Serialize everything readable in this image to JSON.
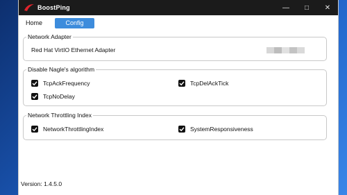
{
  "window": {
    "title": "BoostPing",
    "controls": {
      "minimize": "—",
      "maximize": "□",
      "close": "✕"
    }
  },
  "nav": {
    "home_label": "Home",
    "config_label": "Config",
    "active_tab": "Config",
    "active_color": "#3d8cdc"
  },
  "network_adapter": {
    "legend": "Network Adapter",
    "adapter_name": "Red Hat VirtIO Ethernet Adapter"
  },
  "nagle": {
    "legend": "Disable Nagle's algorithm",
    "options": [
      {
        "label": "TcpAckFrequency",
        "checked": true
      },
      {
        "label": "TcpDelAckTick",
        "checked": true
      },
      {
        "label": "TcpNoDelay",
        "checked": true
      }
    ]
  },
  "throttling": {
    "legend": "Network Throttling Index",
    "options": [
      {
        "label": "NetworkThrottlingIndex",
        "checked": true
      },
      {
        "label": "SystemResponsiveness",
        "checked": true
      }
    ]
  },
  "footer": {
    "version": "Version: 1.4.5.0"
  },
  "icons": {
    "app_logo": "swoosh-logo-icon",
    "checkbox": "checkmark-icon"
  }
}
